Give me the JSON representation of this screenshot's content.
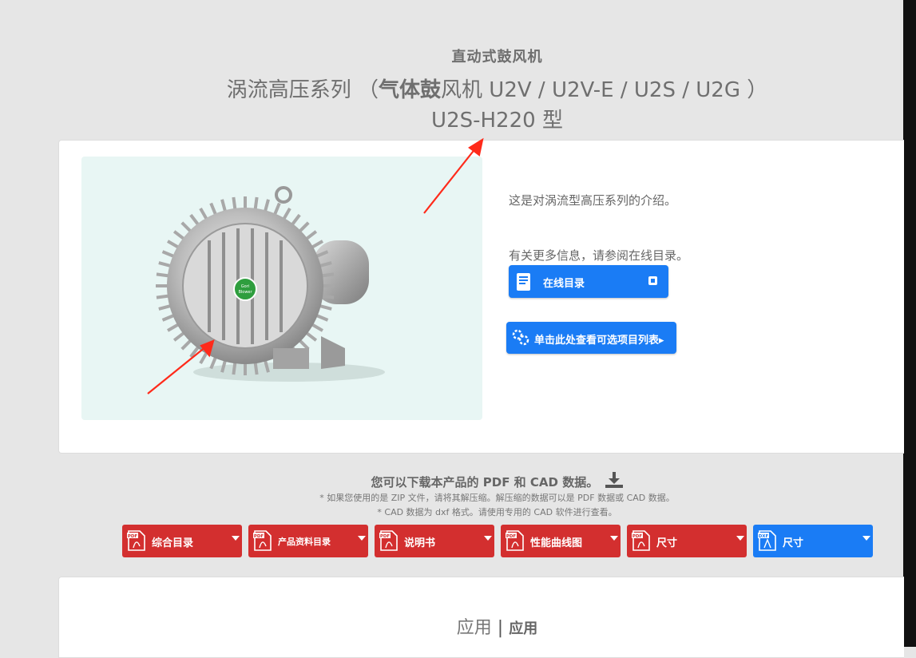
{
  "header": {
    "subtitle": "直动式鼓风机",
    "series_light": "涡流高压系列 （",
    "series_bold": "气体鼓",
    "series_rest": "风机 U2V / U2V-E / U2S / U2G ）",
    "model": "U2S-H220 型"
  },
  "product": {
    "intro": "这是对涡流型高压系列的介绍。",
    "more_info": "有关更多信息，请参阅在线目录。",
    "catalog_button": "在线目录",
    "options_button": "单击此处查看可选项目列表▸",
    "badge_text_1": "Gori",
    "badge_text_2": "Blower"
  },
  "downloads": {
    "title": "您可以下载本产品的 PDF 和 CAD 数据。",
    "note1": "* 如果您使用的是 ZIP 文件，请将其解压缩。解压缩的数据可以是 PDF 数据或 CAD 数据。",
    "note2": "* CAD 数据为 dxf 格式。请使用专用的 CAD 软件进行查看。",
    "pdf_icon_label": "PDF",
    "dxf_icon_label": "DXF",
    "buttons": [
      {
        "label": "综合目录"
      },
      {
        "label": "产品资料目录"
      },
      {
        "label": "说明书"
      },
      {
        "label": "性能曲线图"
      },
      {
        "label": "尺寸"
      },
      {
        "label": "尺寸"
      }
    ]
  },
  "application": {
    "title": "应用",
    "separator": "|",
    "title_bold": "应用"
  },
  "colors": {
    "page_bg": "#e6e6e6",
    "accent_blue": "#1a7cf5",
    "pdf_red": "#d32f2f",
    "annotation_red": "#ff2a1a"
  }
}
